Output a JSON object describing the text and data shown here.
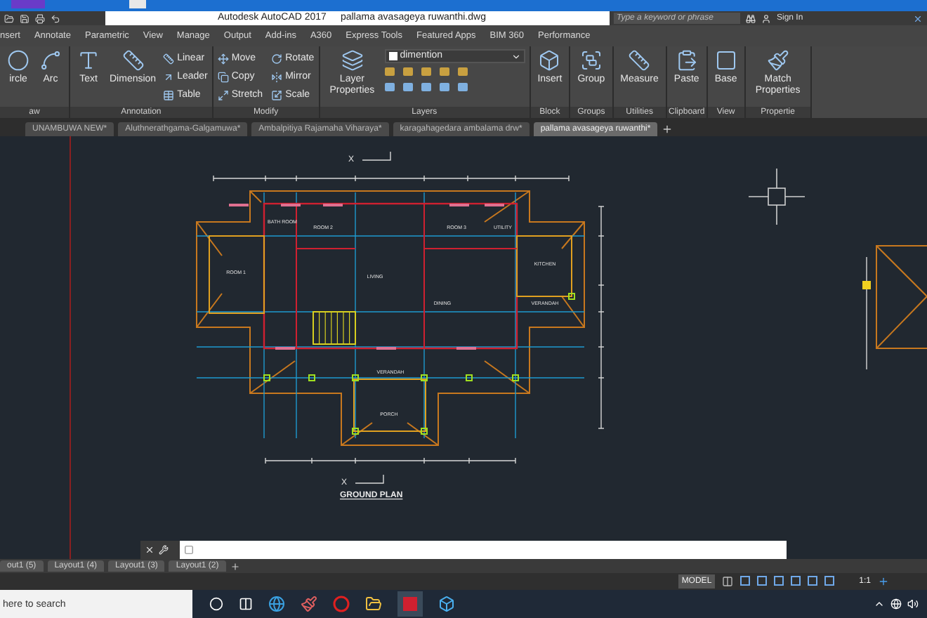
{
  "title_bar": {
    "app": "Autodesk AutoCAD 2017",
    "file": "pallama avasageya ruwanthi.dwg",
    "search": {
      "placeholder": "Type a keyword or phrase"
    },
    "sign_in": "Sign In"
  },
  "ribbon_tabs": [
    "nsert",
    "Annotate",
    "Parametric",
    "View",
    "Manage",
    "Output",
    "Add-ins",
    "A360",
    "Express Tools",
    "Featured Apps",
    "BIM 360",
    "Performance"
  ],
  "panels": [
    {
      "title": "aw",
      "tools": [
        {
          "label": "ircle",
          "kind": "large"
        },
        {
          "label": "Arc",
          "kind": "large"
        }
      ]
    },
    {
      "title": "Annotation",
      "tools": [
        {
          "label": "Text",
          "kind": "large"
        },
        {
          "label": "Dimension",
          "kind": "large"
        },
        {
          "label": "Linear",
          "kind": "small"
        },
        {
          "label": "Leader",
          "kind": "small"
        },
        {
          "label": "Table",
          "kind": "small"
        }
      ]
    },
    {
      "title": "Modify",
      "tools": [
        {
          "label": "Move",
          "kind": "small"
        },
        {
          "label": "Copy",
          "kind": "small"
        },
        {
          "label": "Stretch",
          "kind": "small"
        },
        {
          "label": "Rotate",
          "kind": "small"
        },
        {
          "label": "Mirror",
          "kind": "small"
        },
        {
          "label": "Scale",
          "kind": "small"
        }
      ]
    },
    {
      "title": "Layers",
      "tools": [
        {
          "label": "Layer Properties",
          "kind": "large"
        },
        {
          "label": "dimention",
          "kind": "dropdown"
        }
      ]
    },
    {
      "title": "Block",
      "tools": [
        {
          "label": "Insert",
          "kind": "large"
        }
      ]
    },
    {
      "title": "Groups",
      "tools": [
        {
          "label": "Group",
          "kind": "large"
        }
      ]
    },
    {
      "title": "Utilities",
      "tools": [
        {
          "label": "Measure",
          "kind": "large"
        }
      ]
    },
    {
      "title": "Clipboard",
      "tools": [
        {
          "label": "Paste",
          "kind": "large"
        }
      ]
    },
    {
      "title": "View",
      "tools": [
        {
          "label": "Base",
          "kind": "large"
        }
      ]
    },
    {
      "title": "Propertie",
      "tools": [
        {
          "label": "Match Properties",
          "kind": "large"
        }
      ]
    }
  ],
  "file_tabs": [
    {
      "label": "UNAMBUWA NEW*",
      "selected": false
    },
    {
      "label": "Aluthnerathgama-Galgamuwa*",
      "selected": false
    },
    {
      "label": "Ambalpitiya Rajamaha Viharaya*",
      "selected": false
    },
    {
      "label": "karagahagedara ambalama drw*",
      "selected": false
    },
    {
      "label": "pallama avasageya ruwanthi*",
      "selected": true
    }
  ],
  "drawing": {
    "title": "GROUND PLAN",
    "x_marks": [
      "X",
      "X"
    ],
    "rooms": [
      "BATH ROOM",
      "ROOM 2",
      "ROOM 3",
      "UTILITY",
      "ROOM 1",
      "LIVING",
      "KITCHEN",
      "DINING",
      "VERANDAH",
      "VERANDAH",
      "PORCH"
    ]
  },
  "layout_tabs": [
    "out1 (5)",
    "Layout1 (4)",
    "Layout1 (3)",
    "Layout1 (2)"
  ],
  "status_bar": {
    "model": "MODEL",
    "scale": "1:1"
  },
  "taskbar": {
    "search": {
      "placeholder": "here to search"
    }
  }
}
